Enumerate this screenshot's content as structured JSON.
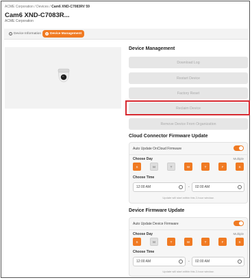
{
  "breadcrumb": {
    "org": "ACME Corporation",
    "sep1": "/",
    "devices": "Devices",
    "sep2": "/",
    "current": "Cam6 XND-C7083RV 59"
  },
  "header": {
    "title": "Cam6 XND-C7083R...",
    "subtitle": "ACME Corporation"
  },
  "tabs": [
    {
      "label": "Device Information",
      "icon": "info-icon"
    },
    {
      "label": "Device Management",
      "icon": "gear-icon",
      "active": true
    }
  ],
  "device_management": {
    "heading": "Device Management",
    "buttons": [
      "Download Log",
      "Restart Device",
      "Factory Reset",
      "Reclaim Device",
      "Remove Device From Organization"
    ]
  },
  "cloud_fw": {
    "heading": "Cloud Connector Firmware Update",
    "auto_label": "Auto Update OnCloud Firmware",
    "choose_day": "Choose Day",
    "multiple": "Multiple",
    "days": [
      {
        "label": "S",
        "selected": true
      },
      {
        "label": "M",
        "selected": false
      },
      {
        "label": "T",
        "selected": false
      },
      {
        "label": "W",
        "selected": true
      },
      {
        "label": "T",
        "selected": true
      },
      {
        "label": "F",
        "selected": true
      },
      {
        "label": "S",
        "selected": true
      }
    ],
    "choose_time": "Choose Time",
    "start": "12:00 AM",
    "dash": "-",
    "end": "02:00 AM",
    "note": "Update will start within this 2-hour window."
  },
  "device_fw": {
    "heading": "Device Firmware Update",
    "auto_label": "Auto Update Device Firmware",
    "choose_day": "Choose Day",
    "multiple": "Multiple",
    "days": [
      {
        "label": "S",
        "selected": true
      },
      {
        "label": "M",
        "selected": false
      },
      {
        "label": "T",
        "selected": true
      },
      {
        "label": "W",
        "selected": true
      },
      {
        "label": "T",
        "selected": true
      },
      {
        "label": "F",
        "selected": true
      },
      {
        "label": "S",
        "selected": true
      }
    ],
    "choose_time": "Choose Time",
    "start": "12:00 AM",
    "dash": "-",
    "end": "02:00 AM",
    "note": "Update will start within this 2-hour window."
  },
  "colors": {
    "accent": "#f07a22",
    "highlight": "#d7282f",
    "disabled_btn": "#e6e6e6"
  }
}
